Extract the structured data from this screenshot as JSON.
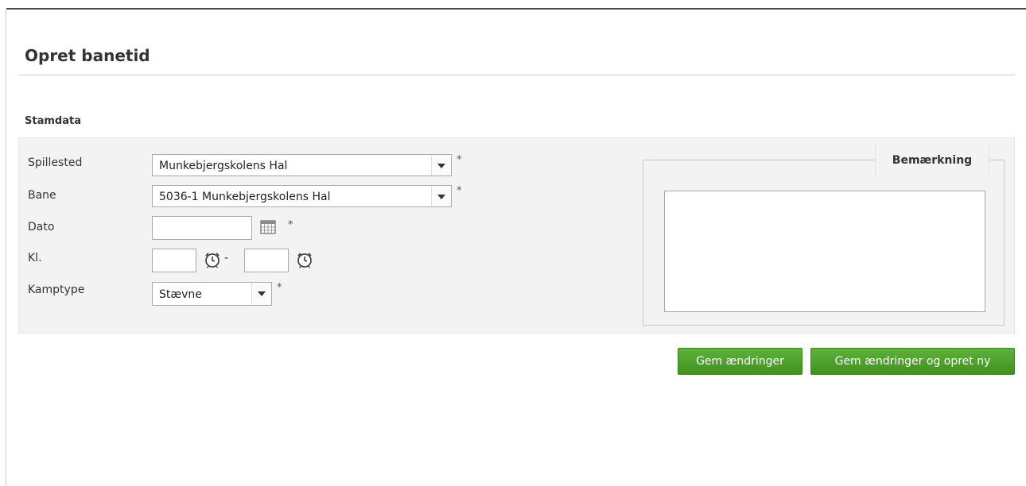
{
  "page": {
    "title": "Opret banetid"
  },
  "section": {
    "title": "Stamdata"
  },
  "form": {
    "required_marker": "*",
    "spillested": {
      "label": "Spillested",
      "value": "Munkebjergskolens Hal"
    },
    "bane": {
      "label": "Bane",
      "value": "5036-1 Munkebjergskolens Hal"
    },
    "dato": {
      "label": "Dato",
      "value": ""
    },
    "kl": {
      "label": "Kl.",
      "from": "",
      "separator": "-",
      "to": ""
    },
    "kamptype": {
      "label": "Kamptype",
      "value": "Stævne"
    }
  },
  "remark": {
    "legend": "Bemærkning",
    "value": ""
  },
  "actions": {
    "save_label": "Gem ændringer",
    "save_new_label": "Gem ændringer og opret ny"
  },
  "icons": {
    "calendar": "calendar-icon",
    "clock": "clock-icon",
    "dropdown": "chevron-down-icon"
  },
  "colors": {
    "button_green": "#4ea32a",
    "panel_bg": "#f3f3f3"
  }
}
